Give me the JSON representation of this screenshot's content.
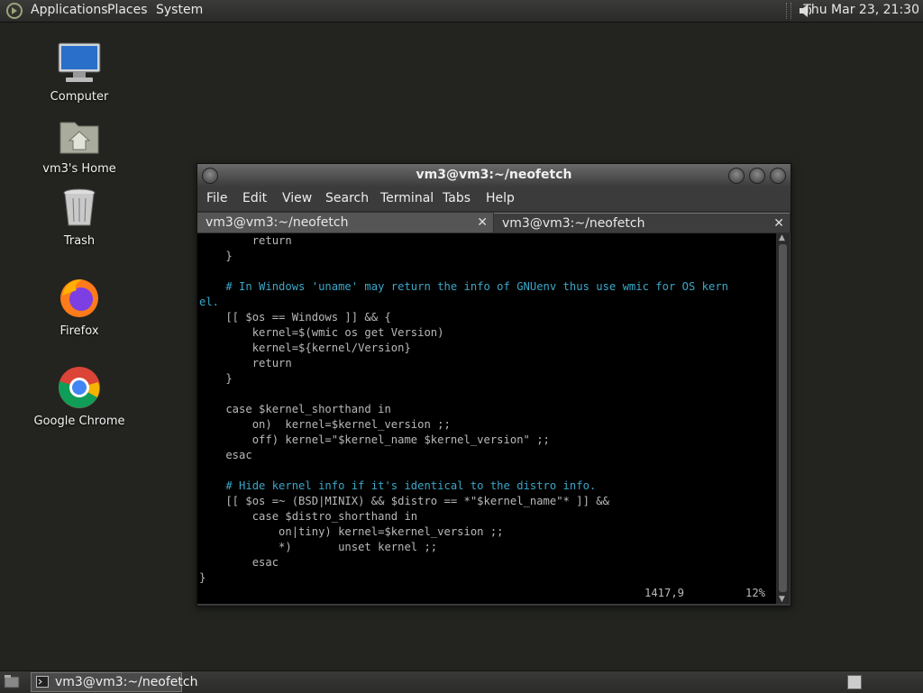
{
  "top_panel": {
    "menus": [
      "Applications",
      "Places",
      "System"
    ],
    "clock": "Thu Mar 23, 21:30"
  },
  "desktop": {
    "icons": [
      {
        "label": "Computer",
        "icon": "computer-icon"
      },
      {
        "label": "vm3's Home",
        "icon": "home-folder-icon"
      },
      {
        "label": "Trash",
        "icon": "trash-icon"
      },
      {
        "label": "Firefox",
        "icon": "firefox-icon"
      },
      {
        "label": "Google Chrome",
        "icon": "chrome-icon"
      }
    ]
  },
  "window": {
    "title": "vm3@vm3:~/neofetch",
    "menus": [
      "File",
      "Edit",
      "View",
      "Search",
      "Terminal",
      "Tabs",
      "Help"
    ],
    "tabs": [
      {
        "label": "vm3@vm3:~/neofetch",
        "active": false
      },
      {
        "label": "vm3@vm3:~/neofetch",
        "active": true
      }
    ]
  },
  "terminal": {
    "lines": [
      "        return",
      "    }",
      "",
      "    # In Windows 'uname' may return the info of GNUenv thus use wmic for OS kern",
      "el.",
      "    [[ $os == Windows ]] && {",
      "        kernel=$(wmic os get Version)",
      "        kernel=${kernel/Version}",
      "        return",
      "    }",
      "",
      "    case $kernel_shorthand in",
      "        on)  kernel=$kernel_version ;;",
      "        off) kernel=\"$kernel_name $kernel_version\" ;;",
      "    esac",
      "",
      "    # Hide kernel info if it's identical to the distro info.",
      "    [[ $os =~ (BSD|MINIX) && $distro == *\"$kernel_name\"* ]] &&",
      "        case $distro_shorthand in",
      "            on|tiny) kernel=$kernel_version ;;",
      "            *)       unset kernel ;;",
      "        esac",
      "}"
    ],
    "status_position": "1417,9",
    "status_percent": "12%"
  },
  "taskbar": {
    "task_label": "vm3@vm3:~/neofetch"
  }
}
